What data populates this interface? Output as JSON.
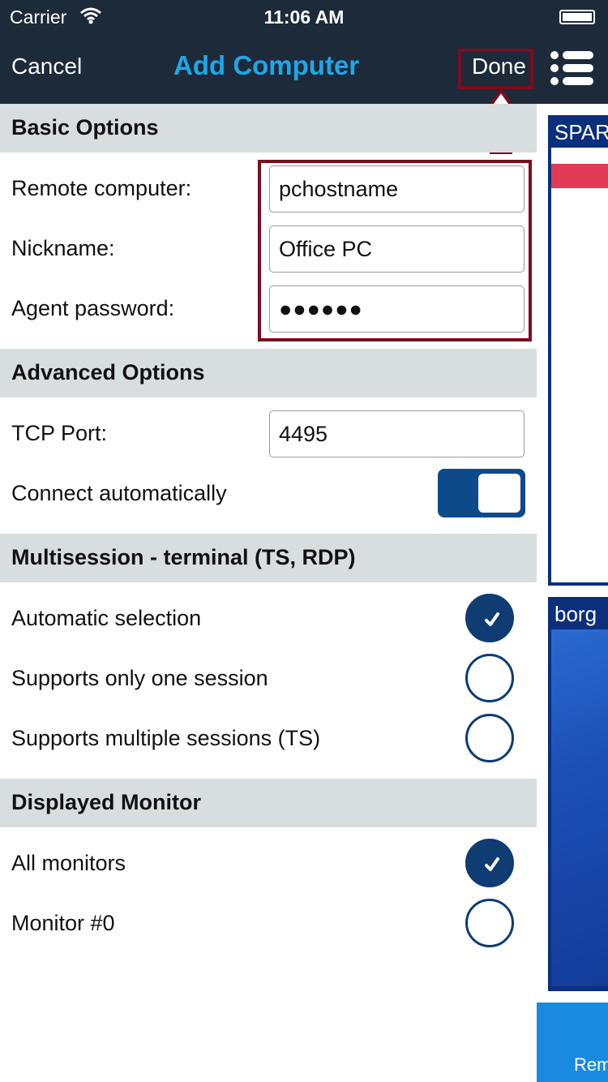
{
  "status_bar": {
    "carrier": "Carrier",
    "time": "11:06 AM"
  },
  "nav": {
    "cancel": "Cancel",
    "title": "Add Computer",
    "done": "Done"
  },
  "basic_options": {
    "header": "Basic Options",
    "remote_computer": {
      "label": "Remote computer:",
      "value": "pchostname"
    },
    "nickname": {
      "label": "Nickname:",
      "value": "Office PC"
    },
    "agent_password": {
      "label": "Agent password:",
      "value": "●●●●●●"
    }
  },
  "advanced_options": {
    "header": "Advanced Options",
    "tcp_port": {
      "label": "TCP Port:",
      "value": "4495"
    },
    "connect_automatically": {
      "label": "Connect automatically",
      "on": true
    }
  },
  "multisession": {
    "header": "Multisession - terminal (TS, RDP)",
    "options": [
      {
        "label": "Automatic selection",
        "checked": true
      },
      {
        "label": "Supports only one session",
        "checked": false
      },
      {
        "label": "Supports multiple sessions (TS)",
        "checked": false
      }
    ]
  },
  "displayed_monitor": {
    "header": "Displayed Monitor",
    "options": [
      {
        "label": "All monitors",
        "checked": true
      },
      {
        "label": "Monitor #0",
        "checked": false
      }
    ]
  },
  "side_panel": {
    "computers": [
      {
        "name": "SPAR"
      },
      {
        "name": "borg"
      }
    ],
    "bottom_label": "Rem"
  },
  "colors": {
    "navbar": "#1d2a3a",
    "title_accent": "#1ea7e8",
    "highlight": "#7a0d1e",
    "control_blue": "#0e3c73"
  },
  "icons": [
    "wifi-icon",
    "battery-icon",
    "menu-icon",
    "arrow-up-icon",
    "check-icon"
  ]
}
